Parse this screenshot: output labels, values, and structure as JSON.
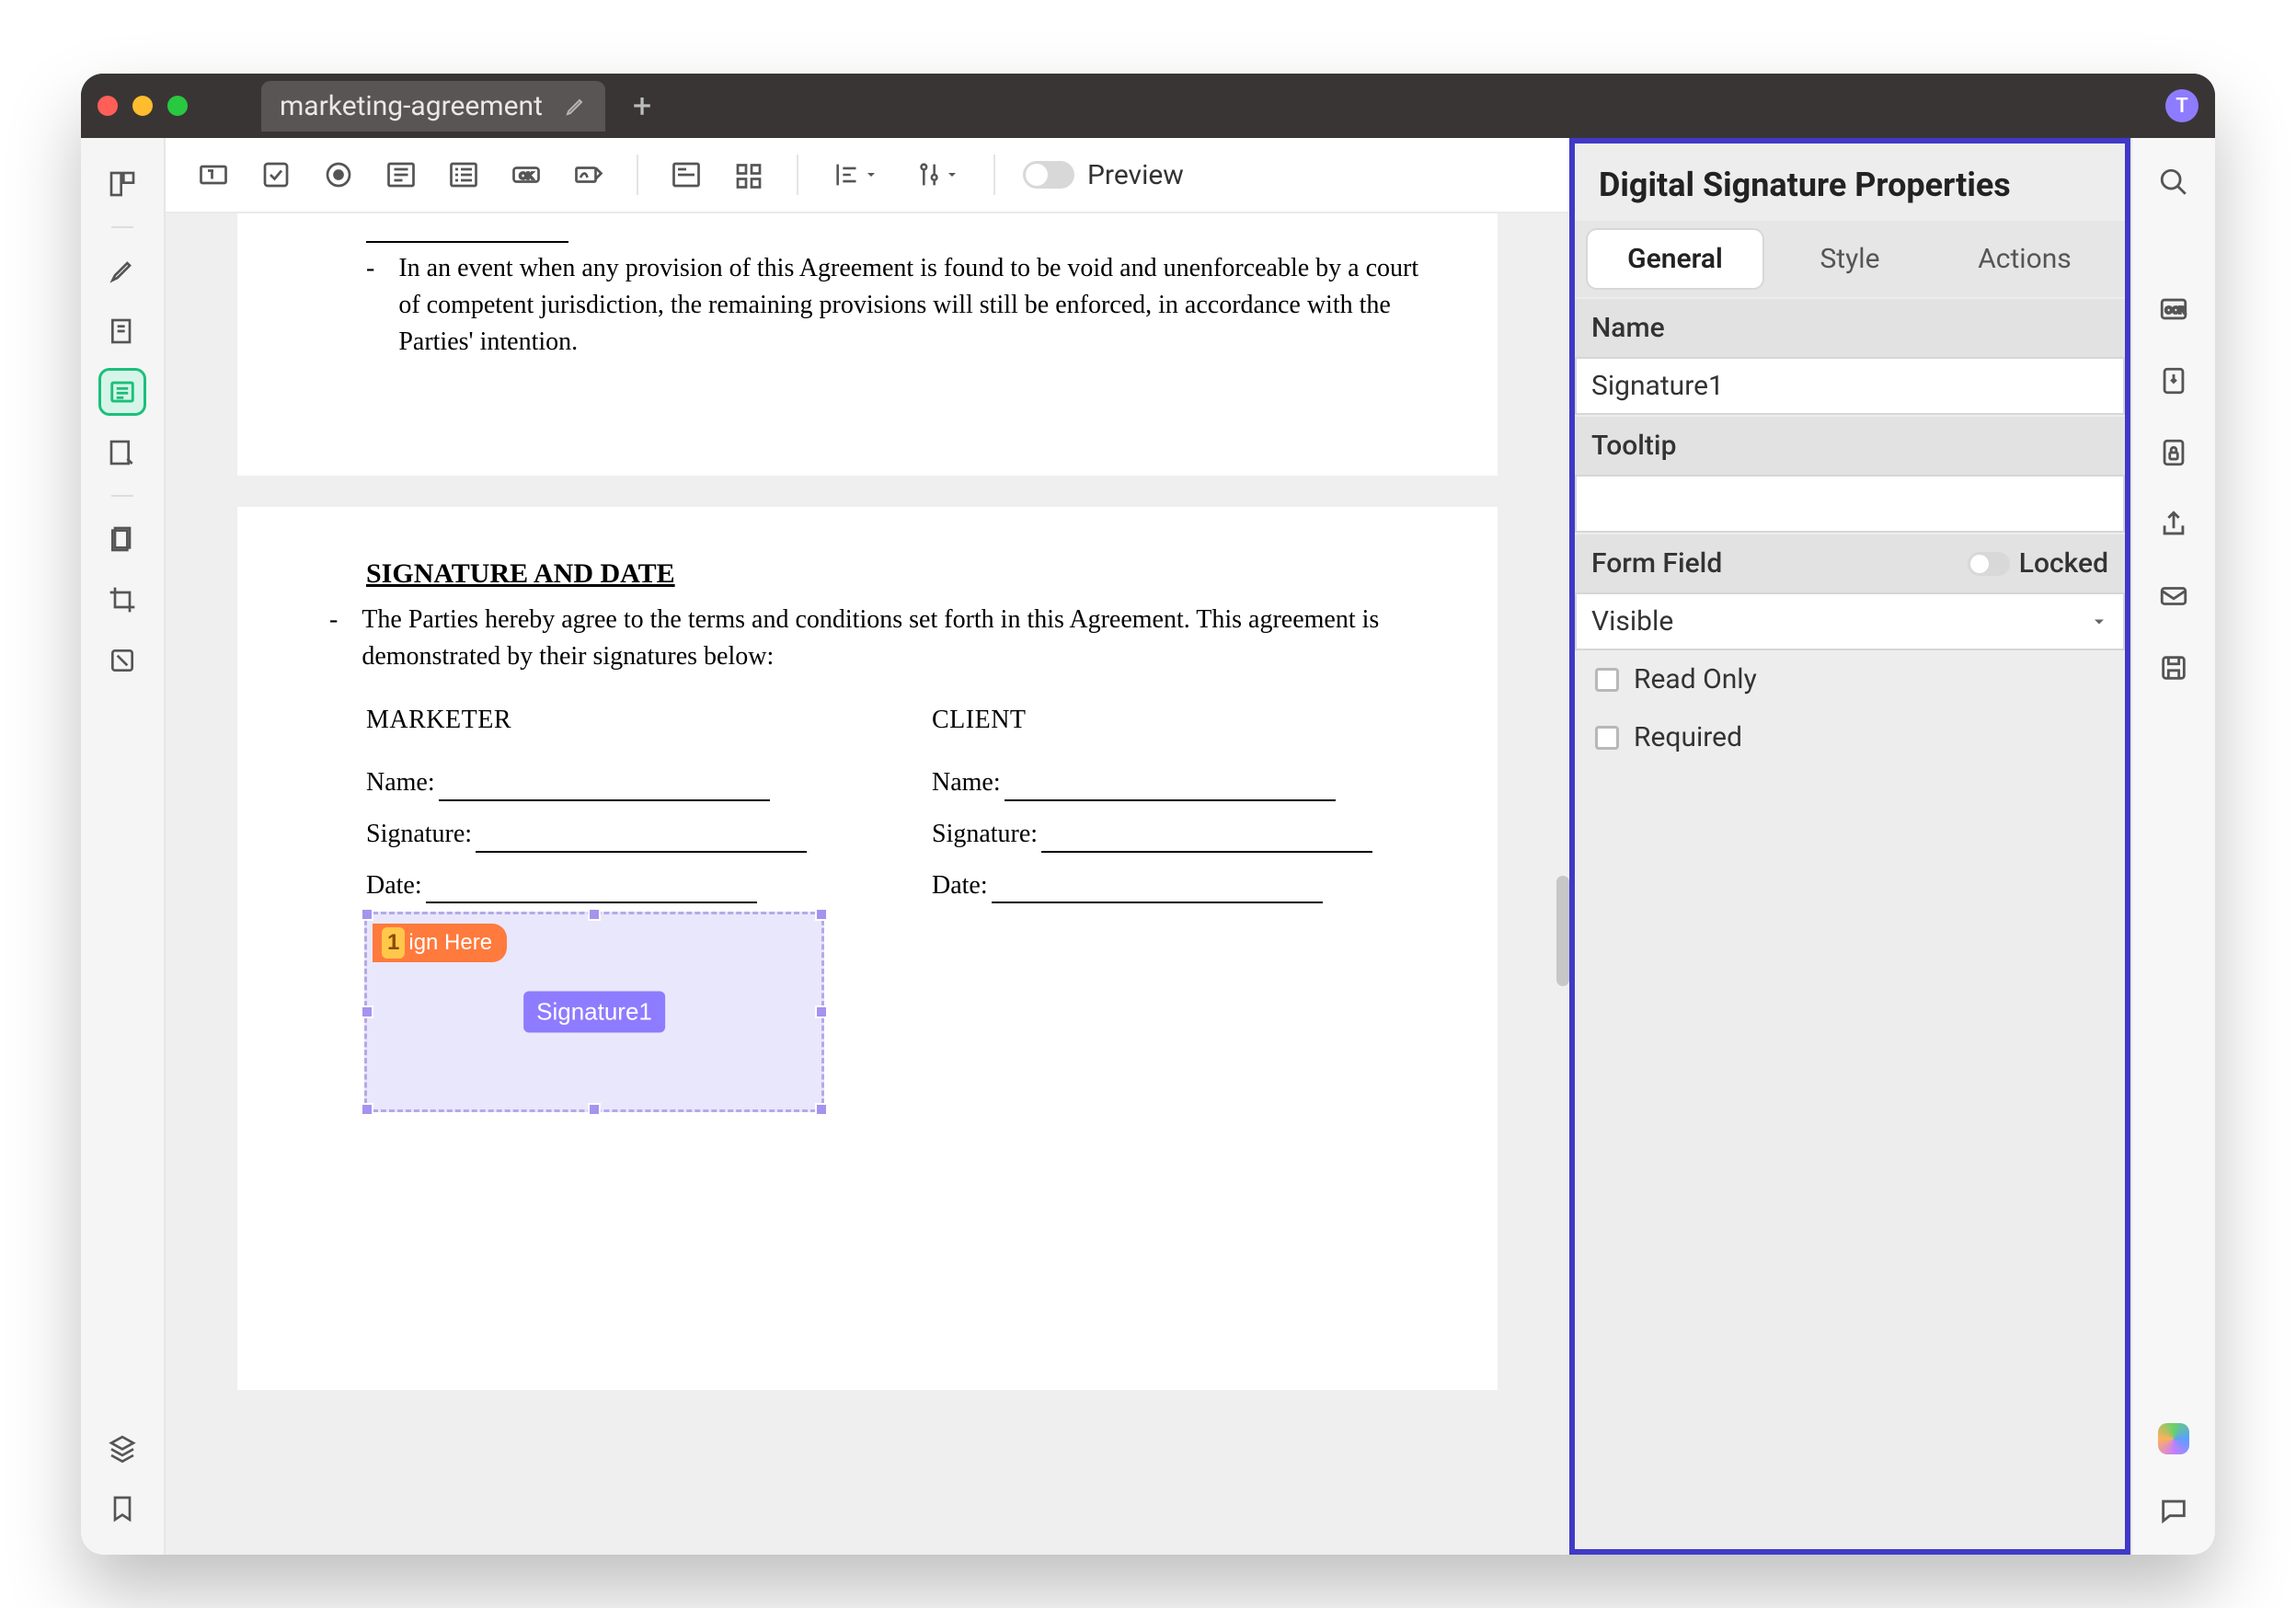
{
  "tab": {
    "title": "marketing-agreement"
  },
  "avatar": "T",
  "toolbar": {
    "preview": "Preview"
  },
  "document": {
    "topParagraph": "In an event when any provision of this Agreement is found to be void and unenforceable by a court of competent jurisdiction, the remaining provisions will still be enforced, in accordance with the Parties' intention.",
    "sectionHeader": "SIGNATURE AND DATE",
    "intro": "The Parties hereby agree to the terms and conditions set forth in this Agreement. This agreement is demonstrated by their signatures below:",
    "columns": {
      "left": {
        "header": "MARKETER",
        "name": "Name:",
        "signature": "Signature:",
        "date": "Date:"
      },
      "right": {
        "header": "CLIENT",
        "name": "Name:",
        "signature": "Signature:",
        "date": "Date:"
      }
    },
    "signField": {
      "signHereBadge": "1",
      "signHere": "ign Here",
      "label": "Signature1"
    }
  },
  "properties": {
    "title": "Digital Signature Properties",
    "tabs": {
      "general": "General",
      "style": "Style",
      "actions": "Actions"
    },
    "nameLabel": "Name",
    "nameValue": "Signature1",
    "tooltipLabel": "Tooltip",
    "tooltipValue": "",
    "formFieldLabel": "Form Field",
    "lockedLabel": "Locked",
    "visibility": "Visible",
    "readOnly": "Read Only",
    "required": "Required"
  }
}
